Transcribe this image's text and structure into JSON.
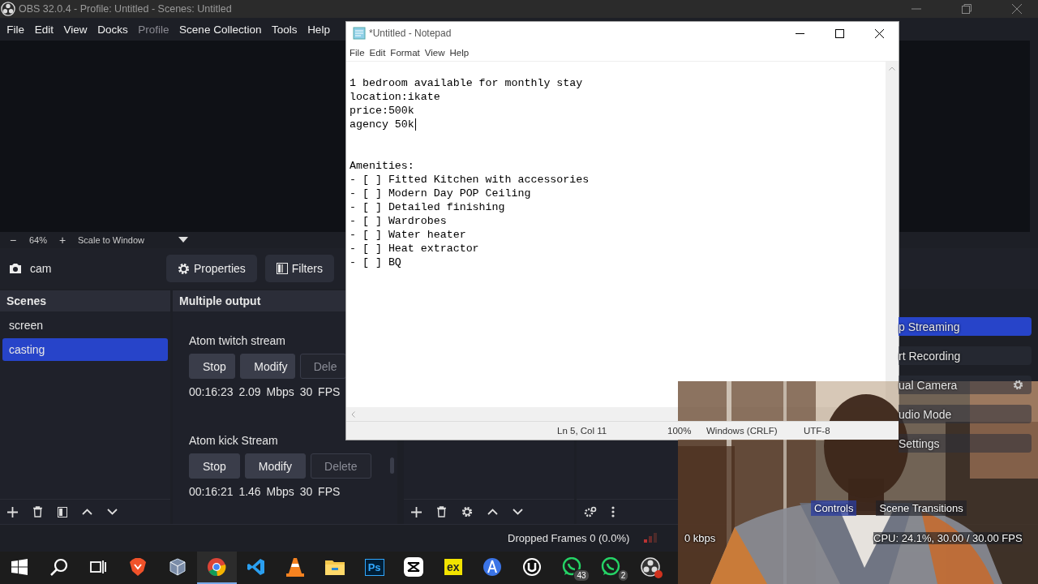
{
  "obs": {
    "title": "OBS 32.0.4 - Profile: Untitled - Scenes: Untitled",
    "menu": [
      {
        "label": "File",
        "disabled": false
      },
      {
        "label": "Edit",
        "disabled": false
      },
      {
        "label": "View",
        "disabled": false
      },
      {
        "label": "Docks",
        "disabled": false
      },
      {
        "label": "Profile",
        "disabled": true
      },
      {
        "label": "Scene Collection",
        "disabled": false
      },
      {
        "label": "Tools",
        "disabled": false
      },
      {
        "label": "Help",
        "disabled": false
      }
    ],
    "zoom": {
      "minus": "−",
      "percent": "64%",
      "plus": "+",
      "scale": "Scale to Window"
    },
    "source": {
      "name": "cam",
      "buttons": [
        {
          "kind": "gear",
          "label": "Properties"
        },
        {
          "kind": "filter",
          "label": "Filters"
        }
      ]
    },
    "scenes": {
      "title": "Scenes",
      "items": [
        {
          "label": "screen",
          "selected": false
        },
        {
          "label": "casting",
          "selected": true
        }
      ]
    },
    "multiple_output": {
      "title": "Multiple output",
      "outputs": [
        {
          "name": "Atom twitch stream",
          "cut": true,
          "buttons": [
            {
              "label": "Stop",
              "disabled": false
            },
            {
              "label": "Modify",
              "disabled": false
            },
            {
              "label": "Dele",
              "disabled": true
            }
          ],
          "stats": "00:16:23 2.09 Mbps 30 FPS"
        },
        {
          "name": "Atom kick Stream",
          "cut": false,
          "buttons": [
            {
              "label": "Stop",
              "disabled": false
            },
            {
              "label": "Modify",
              "disabled": false
            },
            {
              "label": "Delete",
              "disabled": true
            }
          ],
          "stats": "00:16:21 1.46 Mbps 30 FPS"
        }
      ]
    },
    "controls": {
      "buttons": [
        {
          "label": "p Streaming",
          "active": true,
          "kind": "plain"
        },
        {
          "label": "rt Recording",
          "active": false,
          "kind": "plain"
        },
        {
          "label": "ual Camera",
          "active": false,
          "kind": "settings"
        },
        {
          "label": "udio Mode",
          "active": false,
          "kind": "plain"
        },
        {
          "label": "Settings",
          "active": false,
          "kind": "plain"
        }
      ],
      "tabs": [
        {
          "label": "Controls",
          "selected": true
        },
        {
          "label": "Scene Transitions",
          "selected": false
        }
      ]
    },
    "status_bar": {
      "dropped_frames": "Dropped Frames 0 (0.0%)",
      "bitrate": "0 kbps",
      "cpu": "CPU: 24.1%, 30.00 / 30.00 FPS"
    }
  },
  "notepad": {
    "title": "*Untitled - Notepad",
    "menu": [
      "File",
      "Edit",
      "Format",
      "View",
      "Help"
    ],
    "paragraphs": [
      {
        "caret": true,
        "lines": [
          "1 bedroom available for monthly stay",
          "location:ikate",
          "price:500k",
          "agency 50k"
        ]
      },
      {
        "caret": false,
        "lines": [
          "Amenities:",
          "- [ ] Fitted Kitchen with accessories",
          "- [ ] Modern Day POP Ceiling",
          "- [ ] Detailed finishing",
          "- [ ] Wardrobes",
          "- [ ] Water heater",
          "- [ ] Heat extractor",
          "- [ ] BQ"
        ]
      }
    ],
    "status": [
      "Ln 5, Col 11",
      "100%",
      "Windows (CRLF)",
      "UTF-8"
    ]
  },
  "taskbar": {
    "items": [
      {
        "kind": "windows",
        "active": false
      },
      {
        "kind": "search",
        "active": false
      },
      {
        "kind": "taskview",
        "active": false
      },
      {
        "kind": "lion",
        "active": false
      },
      {
        "kind": "cube",
        "active": false
      },
      {
        "kind": "chrome",
        "active": true
      },
      {
        "kind": "code",
        "active": false
      },
      {
        "kind": "cone",
        "active": false
      },
      {
        "kind": "folder",
        "active": false
      },
      {
        "kind": "text",
        "label": "Ps",
        "active": false
      },
      {
        "kind": "clapper",
        "active": false
      },
      {
        "kind": "text2",
        "label": "ex",
        "active": false
      },
      {
        "kind": "compass",
        "active": false
      },
      {
        "kind": "unreal",
        "active": false
      },
      {
        "kind": "chat",
        "badge": "43",
        "active": false
      },
      {
        "kind": "chat",
        "badge": "2",
        "active": false
      },
      {
        "kind": "obs",
        "active": false
      }
    ]
  }
}
